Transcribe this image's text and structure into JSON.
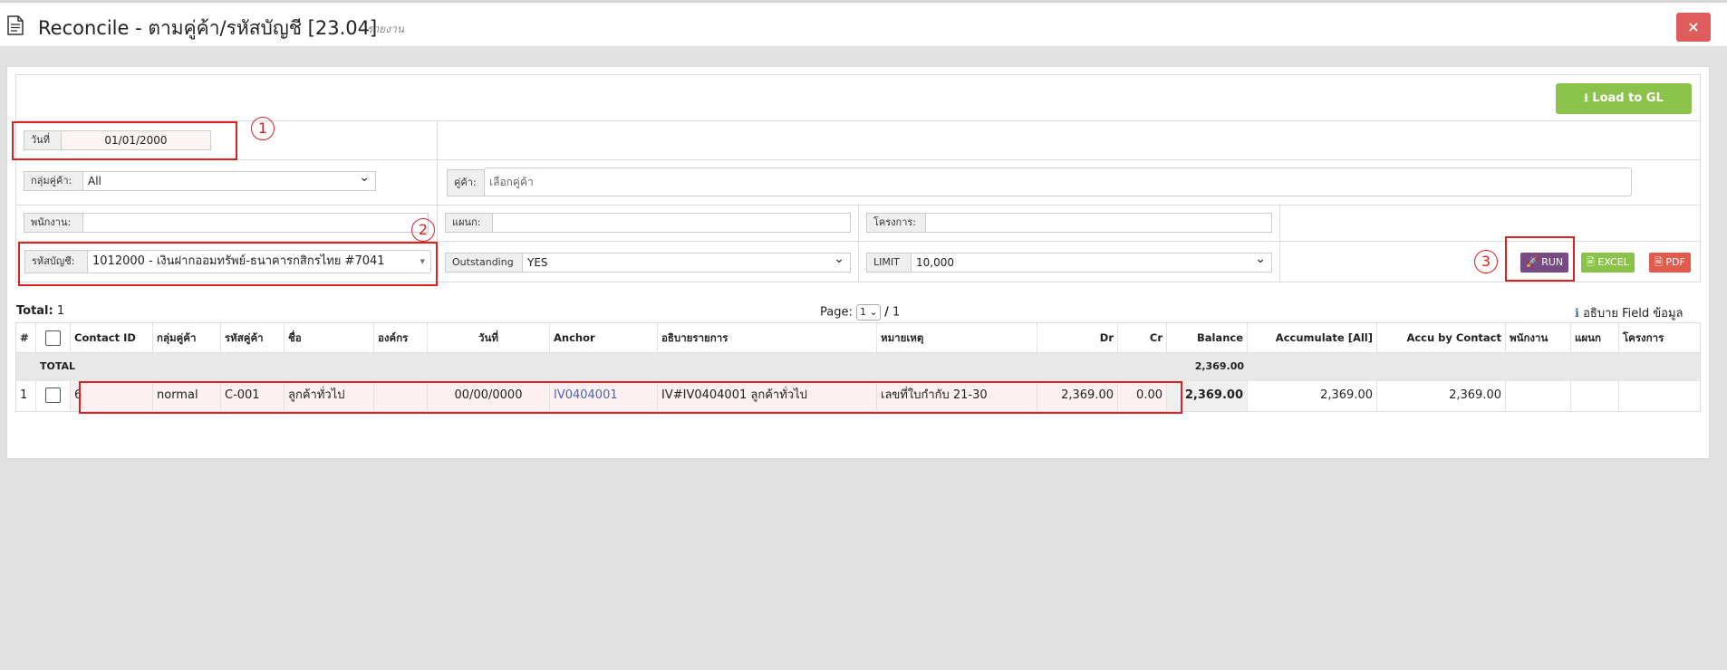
{
  "title": "Reconcile - ตามคู่ค้า/รหัสบัญชี [23.04]",
  "subtitle": "รายงาน",
  "close_label": "×",
  "load_button": "⭳ Load to GL",
  "filters": {
    "date_label": "วันที่",
    "date_value": "01/01/2000",
    "group_label": "กลุ่มคู่ค้า:",
    "group_value": "All",
    "contact_label": "คู่ค้า:",
    "contact_placeholder": "เลือกคู่ค้า",
    "employee_label": "พนักงาน:",
    "employee_value": "",
    "dept_label": "แผนก:",
    "dept_value": "",
    "project_label": "โครงการ:",
    "project_value": "",
    "account_label": "รหัสบัญชี:",
    "account_value": "1012000 - เงินฝากออมทรัพย์-ธนาคารกสิกรไทย #7041",
    "outstanding_label": "Outstanding",
    "outstanding_value": "YES",
    "limit_label": "LIMIT",
    "limit_value": "10,000"
  },
  "actions": {
    "run": "🚀 RUN",
    "excel": "🗎 EXCEL",
    "pdf": "🗎 PDF"
  },
  "markers": [
    "1",
    "2",
    "3"
  ],
  "summary": {
    "total_label": "Total:",
    "total_value": "1",
    "page_label": "Page:",
    "page_current": "1",
    "page_sep": "/",
    "page_total": "1",
    "info_icon": "ℹ",
    "field_help": "อธิบาย Field ข้อมูล"
  },
  "table": {
    "headers": [
      "#",
      "",
      "Contact ID",
      "กลุ่มคู่ค้า",
      "รหัสคู่ค้า",
      "ชื่อ",
      "องค์กร",
      "วันที่",
      "Anchor",
      "อธิบายรายการ",
      "หมายเหตุ",
      "Dr",
      "Cr",
      "Balance",
      "Accumulate [All]",
      "Accu by Contact",
      "พนักงาน",
      "แผนก",
      "โครงการ"
    ],
    "total_row": {
      "label": "TOTAL",
      "balance": "2,369.00"
    },
    "rows": [
      {
        "num": "1",
        "contact_id": "6",
        "group": "normal",
        "code": "C-001",
        "name": "ลูกค้าทั่วไป",
        "org": "",
        "date": "00/00/0000",
        "anchor": "IV0404001",
        "desc": "IV#IV0404001 ลูกค้าทั่วไป",
        "note": "เลขที่ใบกำกับ 21-30",
        "dr": "2,369.00",
        "cr": "0.00",
        "balance": "2,369.00",
        "acc_all": "2,369.00",
        "acc_contact": "2,369.00",
        "employee": "",
        "dept": "",
        "project": ""
      }
    ]
  }
}
